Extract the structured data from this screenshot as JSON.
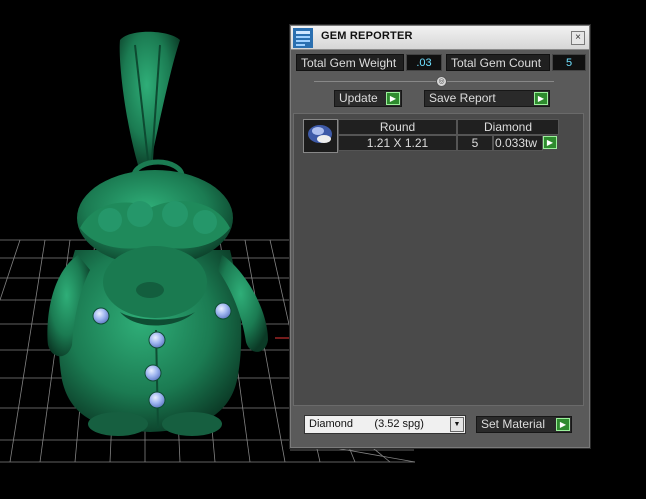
{
  "window": {
    "title": "GEM REPORTER",
    "close_glyph": "×"
  },
  "stats": {
    "total_weight_label": "Total Gem Weight",
    "total_weight_value": ".03",
    "total_count_label": "Total Gem Count",
    "total_count_value": "5"
  },
  "slider_glyph": "◎",
  "actions": {
    "update_label": "Update",
    "save_report_label": "Save Report",
    "arrow_glyph": "▶"
  },
  "gem_table": {
    "rows": [
      {
        "shape": "Round",
        "material": "Diamond",
        "size": "1.21 X 1.21",
        "count": "5",
        "weight": "0.033tw"
      }
    ]
  },
  "material_picker": {
    "selected": "Diamond       (3.52 spg)",
    "dropdown_glyph": "▼",
    "set_material_label": "Set Material"
  },
  "colors": {
    "model_green": "#1e7f55",
    "gem_blue": "#8aa6e8",
    "value_cyan": "#6fe0ff",
    "arrow_green": "#2e8b2e"
  }
}
